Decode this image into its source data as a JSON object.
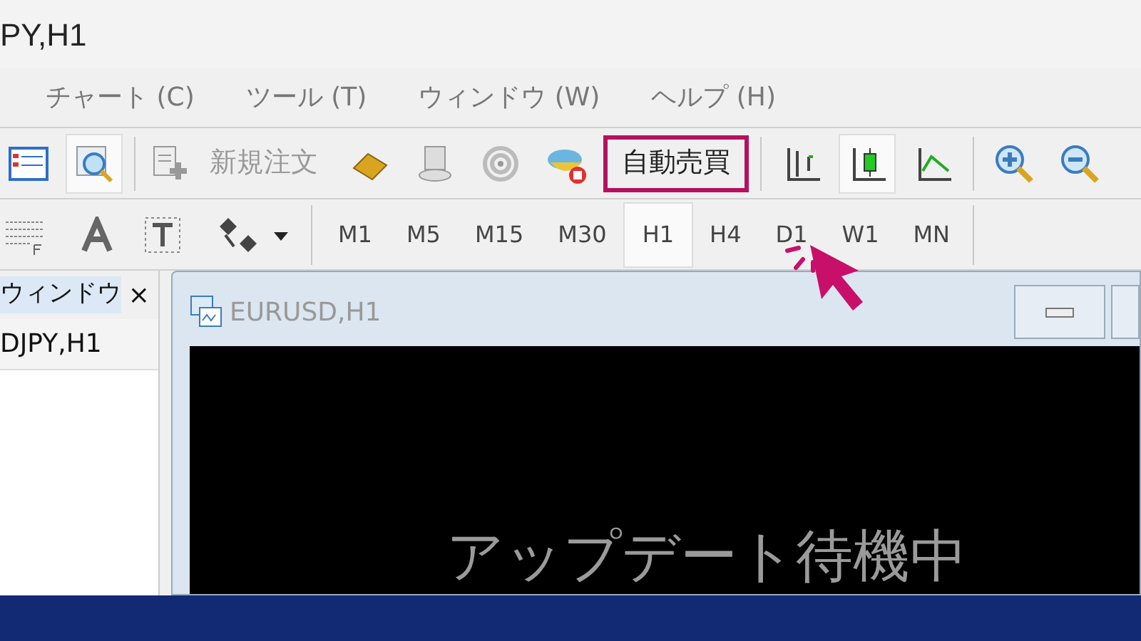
{
  "window": {
    "title": "PY,H1"
  },
  "menu": [
    {
      "label": "チャート (C)"
    },
    {
      "label": "ツール (T)"
    },
    {
      "label": "ウィンドウ (W)"
    },
    {
      "label": "ヘルプ (H)"
    }
  ],
  "toolbar": [
    {
      "kind": "icon",
      "selected": false
    },
    {
      "kind": "icon",
      "selected": true
    },
    {
      "kind": "sep"
    },
    {
      "kind": "text",
      "label": "新規注文",
      "highlighted": false
    },
    {
      "kind": "icon",
      "selected": false
    },
    {
      "kind": "icon",
      "selected": false
    },
    {
      "kind": "icon",
      "selected": false
    },
    {
      "kind": "icon",
      "selected": false
    },
    {
      "kind": "text",
      "label": "自動売買",
      "highlighted": true
    },
    {
      "kind": "sep"
    },
    {
      "kind": "icon",
      "selected": false
    },
    {
      "kind": "icon",
      "selected": true
    },
    {
      "kind": "icon",
      "selected": false
    },
    {
      "kind": "sep"
    },
    {
      "kind": "icon",
      "selected": false
    },
    {
      "kind": "icon",
      "selected": false
    }
  ],
  "timeframes": [
    {
      "label": "M1",
      "selected": false
    },
    {
      "label": "M5",
      "selected": false
    },
    {
      "label": "M15",
      "selected": false
    },
    {
      "label": "M30",
      "selected": false
    },
    {
      "label": "H1",
      "selected": true
    },
    {
      "label": "H4",
      "selected": false
    },
    {
      "label": "D1",
      "selected": false
    },
    {
      "label": "W1",
      "selected": false
    },
    {
      "label": "MN",
      "selected": false
    }
  ],
  "panel": {
    "title": "ウィンドウ",
    "close": "×",
    "items": [
      {
        "label": "DJPY,H1"
      }
    ]
  },
  "chart_window": {
    "title": "EURUSD,H1",
    "message": "アップデート待機中"
  }
}
